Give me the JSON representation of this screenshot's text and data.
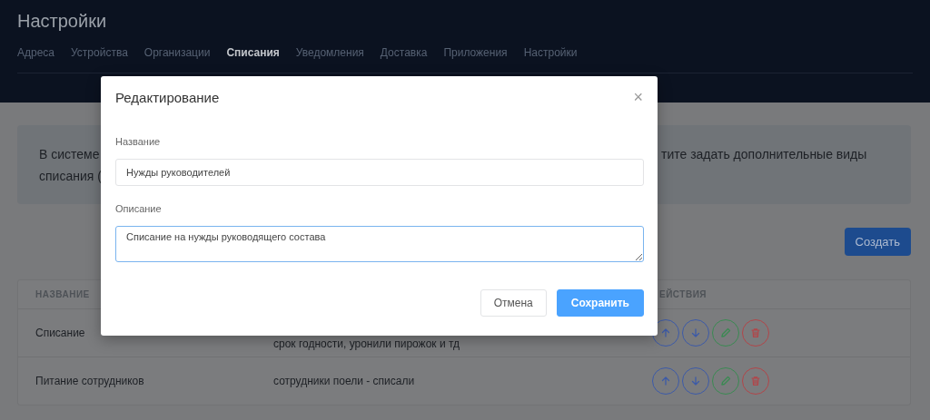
{
  "header": {
    "title": "Настройки",
    "tabs": [
      {
        "label": "Адреса",
        "selected": false
      },
      {
        "label": "Устройства",
        "selected": false
      },
      {
        "label": "Организации",
        "selected": false
      },
      {
        "label": "Списания",
        "selected": true
      },
      {
        "label": "Уведомления",
        "selected": false
      },
      {
        "label": "Доставка",
        "selected": false
      },
      {
        "label": "Приложения",
        "selected": false
      },
      {
        "label": "Настройки",
        "selected": false
      }
    ]
  },
  "info": {
    "text_left": [
      "В системе",
      "списания ("
    ],
    "text_right": "тите задать дополнительные виды"
  },
  "create_button": "Создать",
  "table": {
    "columns": [
      "НАЗВАНИЕ",
      "ЕЙСТВИЯ"
    ],
    "rows": [
      {
        "name": "Списание",
        "description": "срок годности, уронили пирожок и тд"
      },
      {
        "name": "Питание сотрудников",
        "description": "сотрудники поели - списали"
      }
    ]
  },
  "modal": {
    "title": "Редактирование",
    "close": "×",
    "fields": [
      {
        "kind": "input",
        "label": "Название",
        "value": "Нужды руководителей",
        "focused": false
      },
      {
        "kind": "textarea",
        "label": "Описание",
        "value": "Списание на нужды руководящего состава",
        "focused": true
      }
    ],
    "buttons": [
      {
        "label": "Отмена",
        "kind": "secondary"
      },
      {
        "label": "Сохранить",
        "kind": "primary"
      }
    ]
  }
}
